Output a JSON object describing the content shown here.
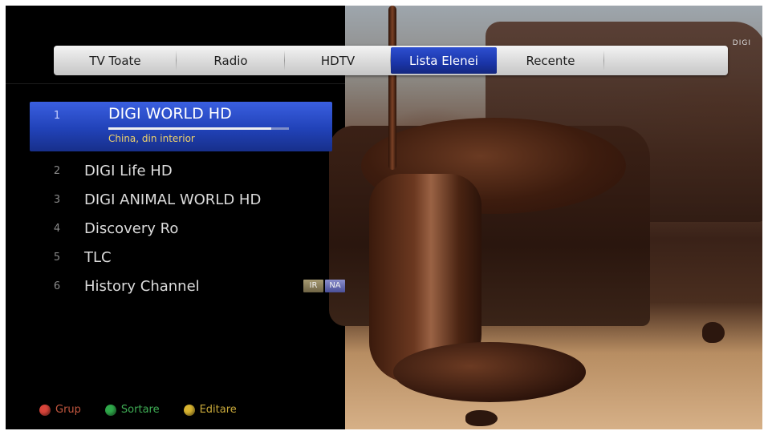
{
  "tabs": [
    {
      "label": "TV Toate",
      "active": false
    },
    {
      "label": "Radio",
      "active": false
    },
    {
      "label": "HDTV",
      "active": false
    },
    {
      "label": "Lista Elenei",
      "active": true
    },
    {
      "label": "Recente",
      "active": false
    },
    {
      "label": "",
      "active": false
    }
  ],
  "channels": [
    {
      "number": "1",
      "name": "DIGI WORLD HD",
      "program": "China, din interior",
      "progress": 0.9,
      "selected": true
    },
    {
      "number": "2",
      "name": "DIGI Life HD"
    },
    {
      "number": "3",
      "name": "DIGI ANIMAL WORLD HD"
    },
    {
      "number": "4",
      "name": "Discovery Ro"
    },
    {
      "number": "5",
      "name": "TLC"
    },
    {
      "number": "6",
      "name": "History Channel",
      "badges": [
        "IR",
        "NA"
      ]
    }
  ],
  "legend": [
    {
      "label": "Grup",
      "color": "#d8443a",
      "text_color": "#c4573f"
    },
    {
      "label": "Sortare",
      "color": "#2fa84a",
      "text_color": "#3fae55"
    },
    {
      "label": "Editare",
      "color": "#d8b430",
      "text_color": "#c9a93a"
    }
  ],
  "video": {
    "channel_logo": "DIGI"
  },
  "colors": {
    "accent": "#2142b8",
    "program_text": "#f0d36b"
  }
}
